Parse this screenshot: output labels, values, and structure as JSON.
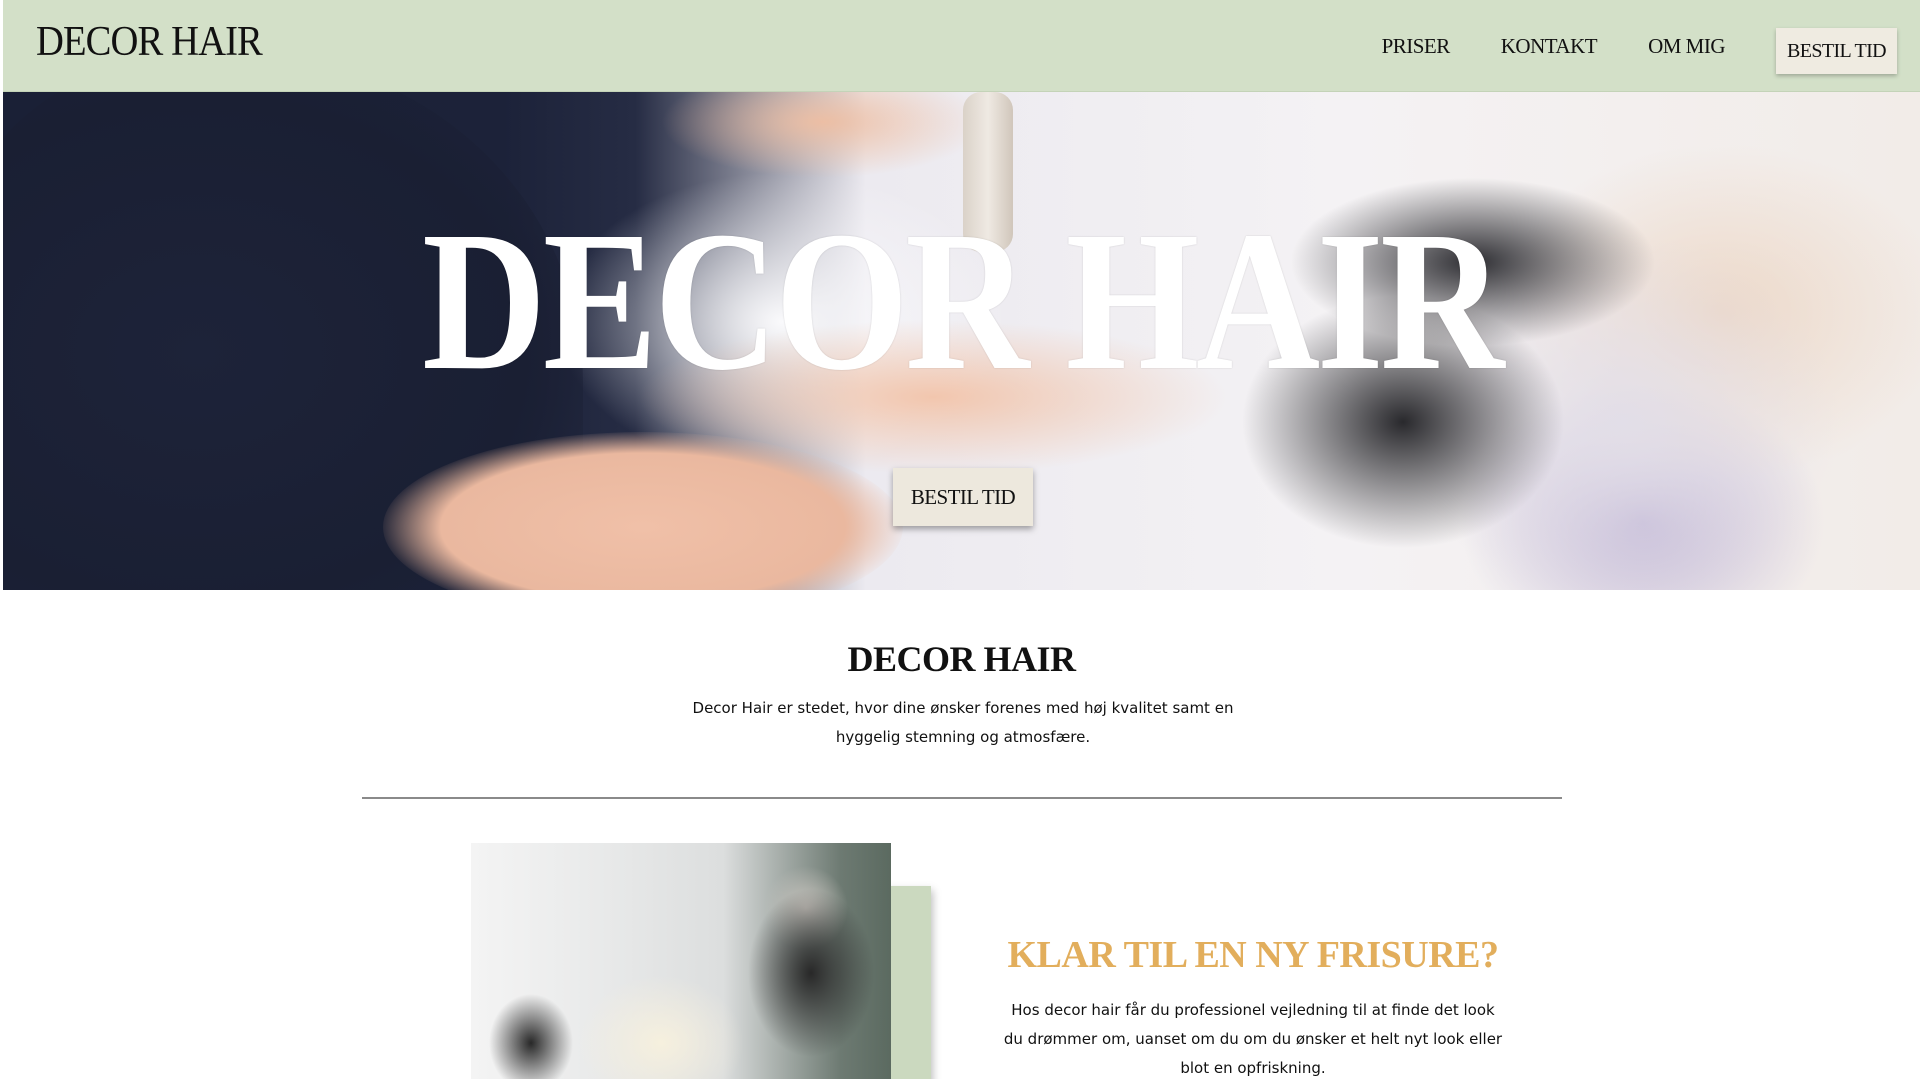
{
  "nav": {
    "logo": "DECOR HAIR",
    "links": [
      "PRISER",
      "KONTAKT",
      "OM MIG"
    ],
    "cta": "BESTIL TID"
  },
  "hero": {
    "title": "DECOR HAIR",
    "cta": "BESTIL TID"
  },
  "intro": {
    "title": "DECOR HAIR",
    "text": "Decor Hair er stedet, hvor dine ønsker forenes med høj kvalitet samt en hyggelig stemning og atmosfære."
  },
  "feature": {
    "title": "KLAR TIL EN NY FRISURE?",
    "text": "Hos decor hair får du professionel vejledning til at finde det look du drømmer om, uanset om du om du ønsker et helt nyt look eller blot en opfriskning."
  },
  "colors": {
    "nav_bg": "#d3e0c8",
    "button_bg": "#ede8dd",
    "accent_gold": "#e2ae5c"
  }
}
